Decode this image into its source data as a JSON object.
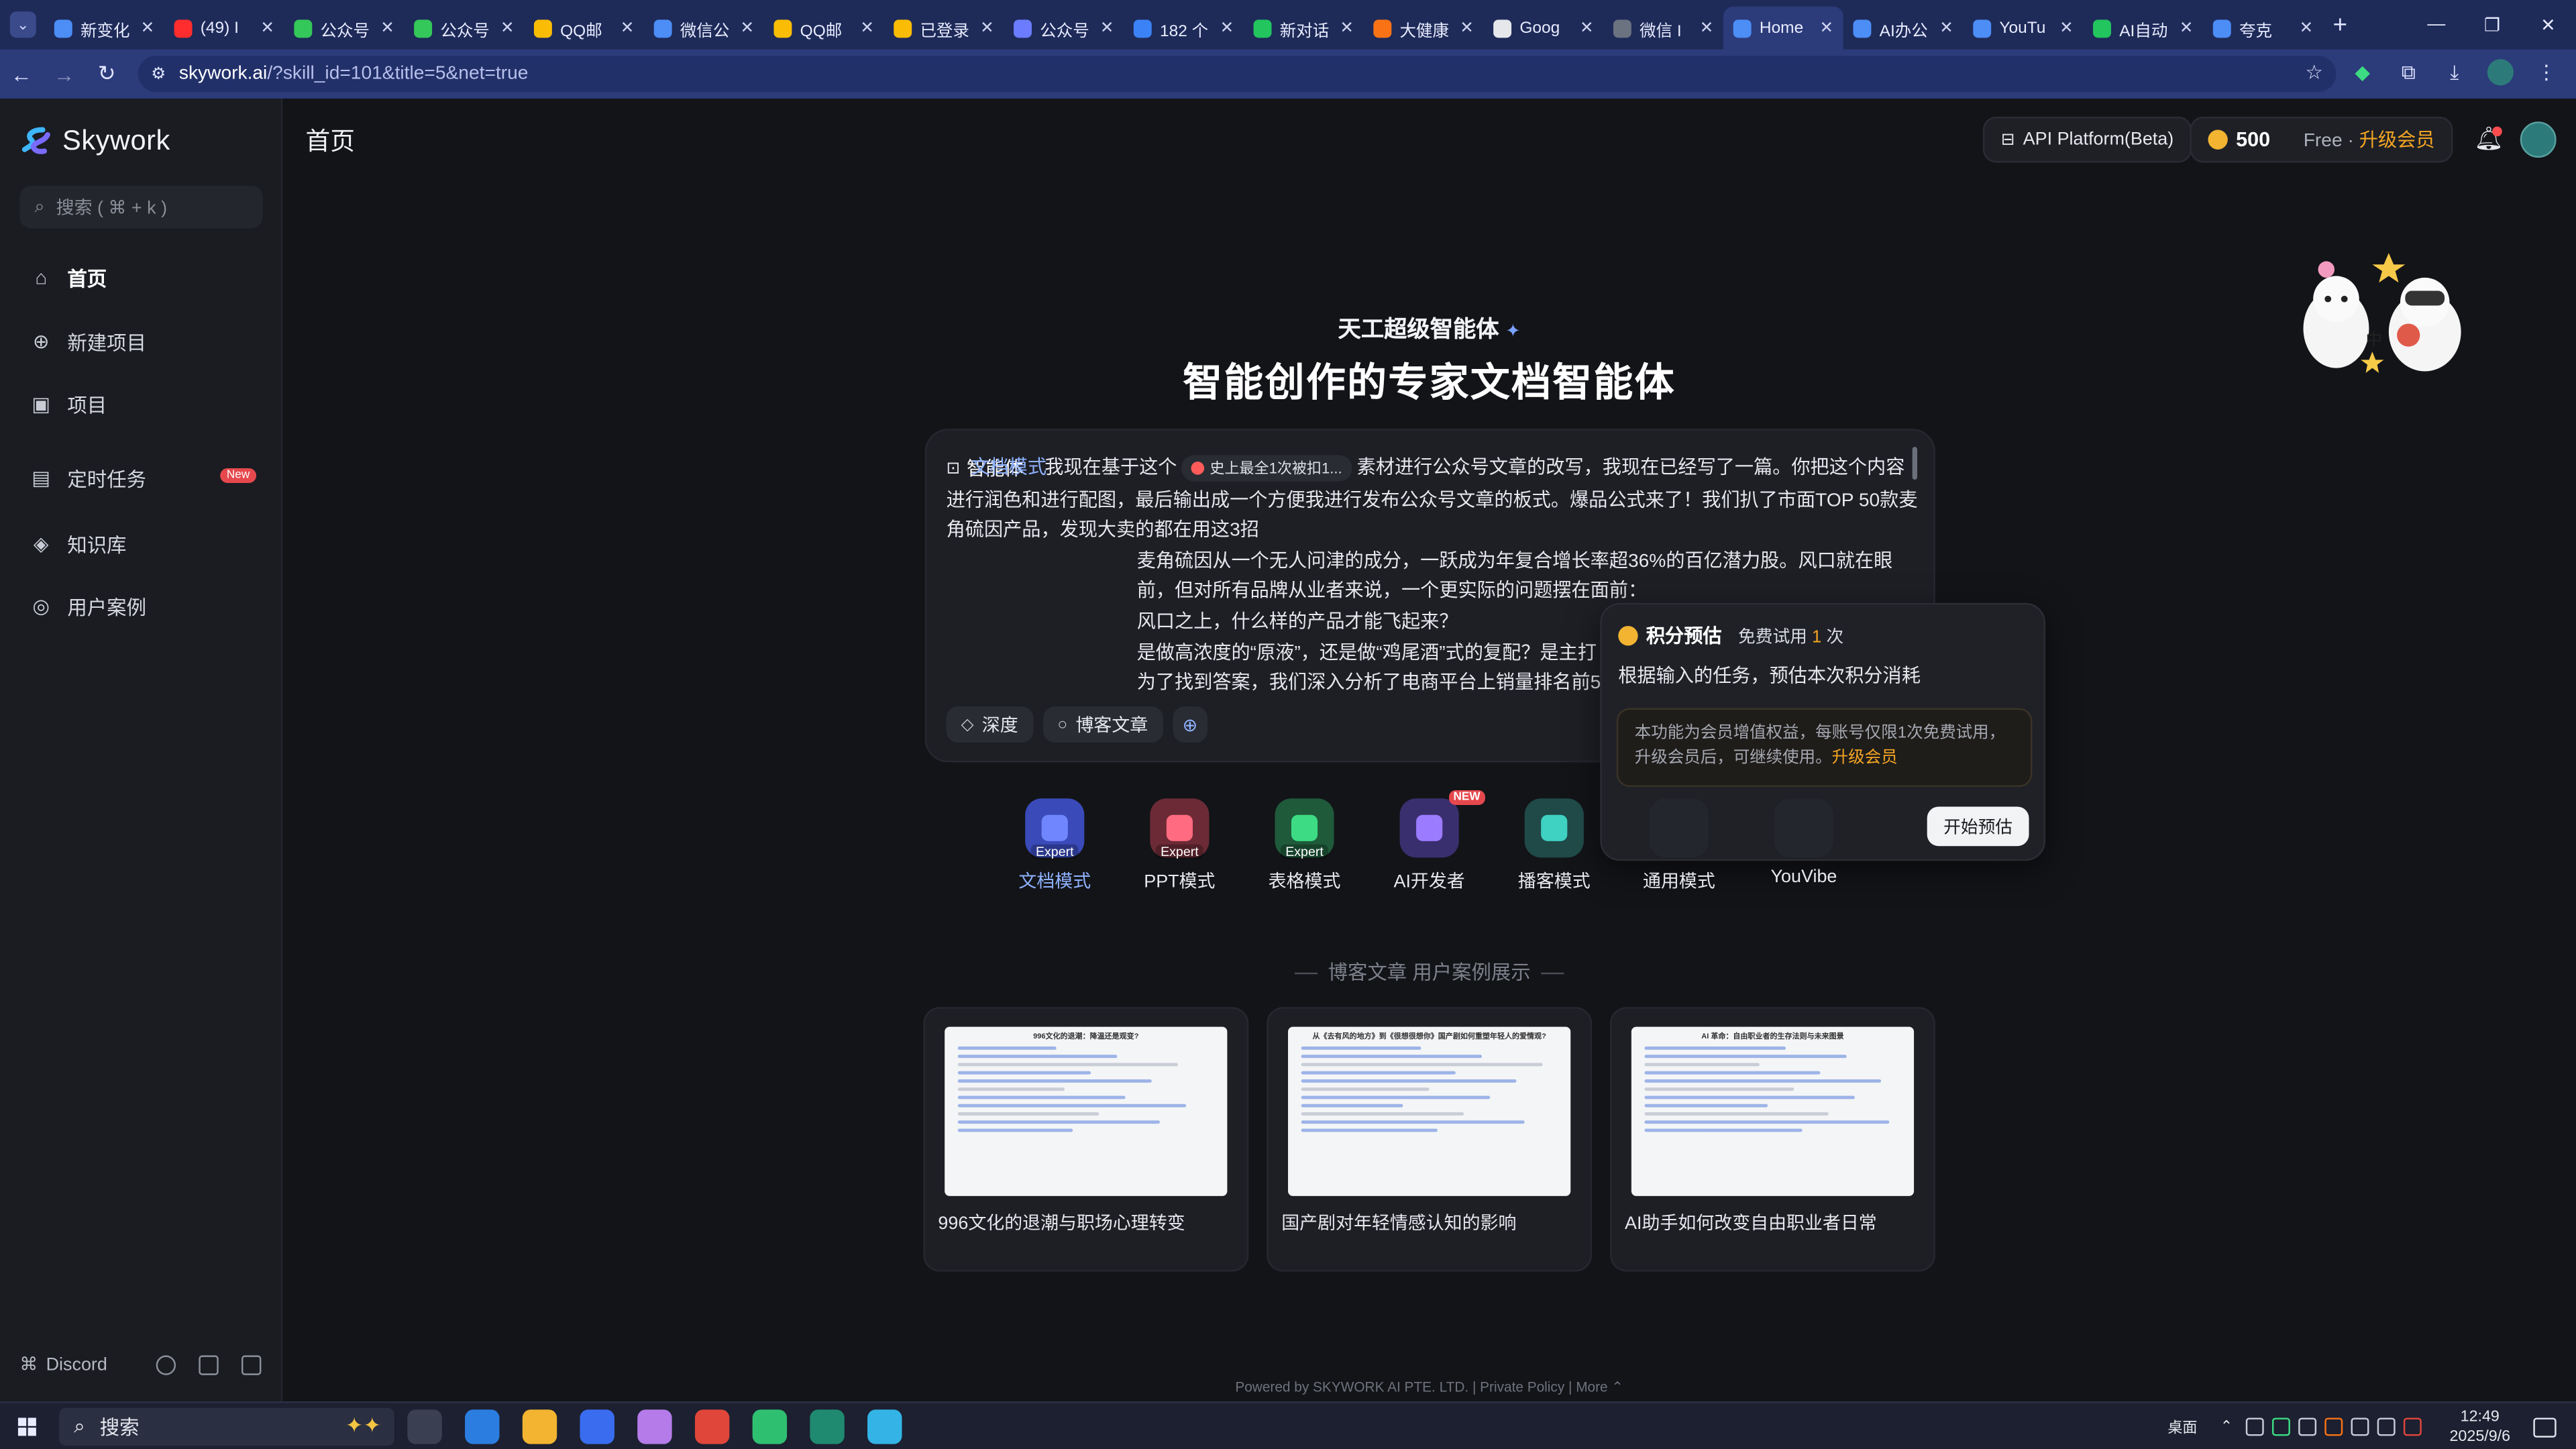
{
  "browser": {
    "tabs": [
      {
        "label": "新变化",
        "color": "#4c8df6"
      },
      {
        "label": "(49) I",
        "color": "#ff2d2d"
      },
      {
        "label": "公众号",
        "color": "#34c759"
      },
      {
        "label": "公众号",
        "color": "#34c759"
      },
      {
        "label": "QQ邮",
        "color": "#fbbc05"
      },
      {
        "label": "微信公",
        "color": "#4c8df6"
      },
      {
        "label": "QQ邮",
        "color": "#fbbc05"
      },
      {
        "label": "已登录",
        "color": "#fbbc05"
      },
      {
        "label": "公众号",
        "color": "#6b7cff"
      },
      {
        "label": "182 个",
        "color": "#3b82f6"
      },
      {
        "label": "新对话",
        "color": "#22c55e"
      },
      {
        "label": "大健康",
        "color": "#f97316"
      },
      {
        "label": "Goog",
        "color": "#e5e7eb"
      },
      {
        "label": "微信 I",
        "color": "#6b7280"
      },
      {
        "label": "Home",
        "color": "#4c8df6"
      },
      {
        "label": "AI办公",
        "color": "#4c8df6"
      },
      {
        "label": "YouTu",
        "color": "#4c8df6"
      },
      {
        "label": "AI自动",
        "color": "#22c55e"
      },
      {
        "label": "夸克",
        "color": "#4c8df6"
      }
    ],
    "active_tab_index": 14,
    "new_tab_symbol": "+",
    "url_host": "skywork.ai",
    "url_path": "/?skill_id=101&title=5&net=true"
  },
  "sidebar": {
    "brand": "Skywork",
    "search_placeholder": "搜索 ( ⌘ + k )",
    "items": [
      {
        "label": "首页",
        "icon": "home-icon",
        "glyph": "⌂",
        "active": true
      },
      {
        "label": "新建项目",
        "icon": "plus-circle-icon",
        "glyph": "⊕"
      },
      {
        "label": "项目",
        "icon": "grid-icon",
        "glyph": "▣"
      },
      {
        "label": "定时任务",
        "icon": "calendar-icon",
        "glyph": "▤",
        "badge": "New"
      },
      {
        "label": "知识库",
        "icon": "cube-icon",
        "glyph": "◈"
      },
      {
        "label": "用户案例",
        "icon": "bulb-icon",
        "glyph": "◎"
      }
    ],
    "footer_link": "Discord"
  },
  "header": {
    "page_title": "首页",
    "api_platform": "API Platform(Beta)",
    "credits": "500",
    "plan": "Free",
    "separator": "·",
    "upgrade": "升级会员"
  },
  "hero": {
    "kicker": "天工超级智能体",
    "headline": "智能创作的专家文档智能体"
  },
  "prompt": {
    "agent_label": "智能体",
    "mode_label": "文档模式",
    "ref_chip": "史上最全1次被扣1...",
    "line1_pre": "我现在基于这个",
    "line1_post": "素材进行公众号文章的改写，我现在已经写了一篇。你把这个内容进行润色和进行配图，最后输出成一个方便我进行发布公众号文章的板式。爆品公式来了！我们扒了市面TOP 50款麦角硫因产品，发现大卖的都在用这3招",
    "p2": "麦角硫因从一个无人问津的成分，一跃成为年复合增长率超36%的百亿潜力股。风口就在眼前，但对所有品牌从业者来说，一个更实际的问题摆在面前：",
    "p3": "风口之上，什么样的产品才能飞起来？",
    "p4": "是做高浓度的“原液”，还是做“鸡尾酒”式的复配？是主打",
    "p5": "为了找到答案，我们深入分析了电商平台上销量排名前50",
    "btn_depth": "深度",
    "btn_blog": "博客文章"
  },
  "popover": {
    "title": "积分预估",
    "free_pre": "免费试用",
    "free_n": "1",
    "free_post": "次",
    "subtitle": "根据输入的任务，预估本次积分消耗",
    "note": "本功能为会员增值权益，每账号仅限1次免费试用，升级会员后，可继续使用。",
    "note_link": "升级会员",
    "button": "开始预估"
  },
  "modes": [
    {
      "name": "文档模式",
      "tag": "Expert",
      "color": "#3a4ab8",
      "inner": "#6f86ff",
      "selected": true
    },
    {
      "name": "PPT模式",
      "tag": "Expert",
      "color": "#6b2a36",
      "inner": "#ff6b81"
    },
    {
      "name": "表格模式",
      "tag": "Expert",
      "color": "#1f5a3a",
      "inner": "#3ddc84"
    },
    {
      "name": "AI开发者",
      "tag": "",
      "color": "#3a2f6e",
      "inner": "#9b7bff",
      "new": "NEW"
    },
    {
      "name": "播客模式",
      "tag": "",
      "color": "#1f4a48",
      "inner": "#3fd1c2"
    },
    {
      "name": "通用模式",
      "tag": "",
      "color": "#24262d",
      "inner": "#24262d"
    },
    {
      "name": "YouVibe",
      "tag": "",
      "color": "#24262d",
      "inner": "#24262d"
    }
  ],
  "showcase": {
    "heading": "博客文章 用户案例展示",
    "cards": [
      {
        "title": "996文化的退潮与职场心理转变",
        "thumb_title": "996文化的退潮：降温还是观变?"
      },
      {
        "title": "国产剧对年轻情感认知的影响",
        "thumb_title": "从《去有风的地方》到《很想很想你》国产剧如何重塑年轻人的爱情观?"
      },
      {
        "title": "AI助手如何改变自由职业者日常",
        "thumb_title": "AI 革命：自由职业者的生存法则与未来图景"
      }
    ]
  },
  "footer": "Powered by SKYWORK AI PTE. LTD. | Private Policy | More ⌃",
  "taskbar": {
    "search": "搜索",
    "tray_label": "桌面",
    "time": "12:49",
    "date": "2025/9/6",
    "app_colors": [
      "#3b3f52",
      "#2b7de0",
      "#f2b431",
      "#3a6cf0",
      "#b57be8",
      "#e0463a",
      "#2fbf71",
      "#1f8a70",
      "#34b4e6"
    ]
  }
}
